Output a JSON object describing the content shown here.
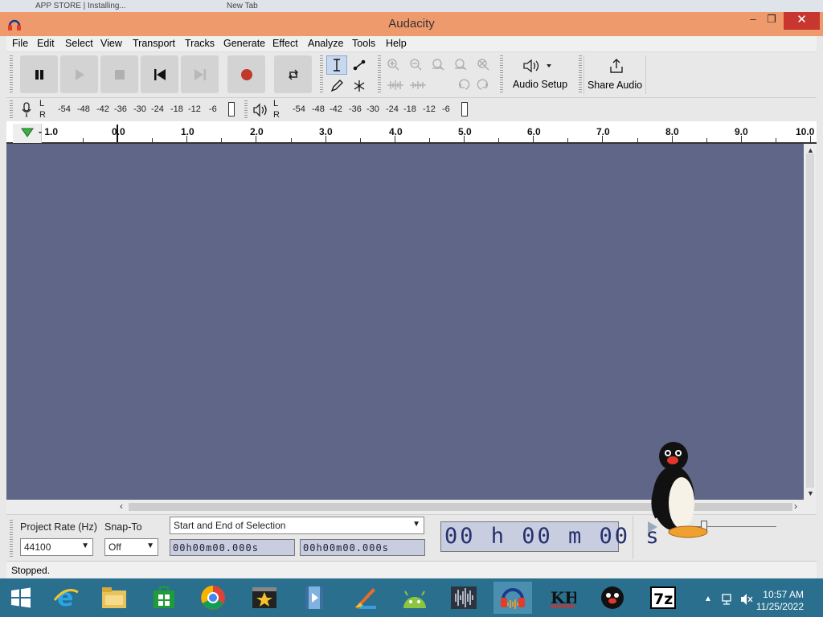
{
  "background_tabs": [
    "APP STORE | Installing...",
    "New Tab"
  ],
  "window": {
    "title": "Audacity",
    "minimize": "–",
    "restore": "❐",
    "close": "✕"
  },
  "menu": [
    "File",
    "Edit",
    "Select",
    "View",
    "Transport",
    "Tracks",
    "Generate",
    "Effect",
    "Analyze",
    "Tools",
    "Help"
  ],
  "toolbar": {
    "audio_setup": "Audio Setup",
    "share_audio": "Share Audio"
  },
  "meters": {
    "record_lr": [
      "L",
      "R"
    ],
    "playback_lr": [
      "L",
      "R"
    ],
    "record_ticks": [
      "-54",
      "-48",
      "-42",
      "-36",
      "-30",
      "-24",
      "-18",
      "-12",
      "-6"
    ],
    "playback_ticks": [
      "-54",
      "-48",
      "-42",
      "-36",
      "-30",
      "-24",
      "-18",
      "-12",
      "-6"
    ]
  },
  "ruler": {
    "labels": [
      "- 1.0",
      "0.0",
      "1.0",
      "2.0",
      "3.0",
      "4.0",
      "5.0",
      "6.0",
      "7.0",
      "8.0",
      "9.0",
      "10.0"
    ]
  },
  "selection": {
    "project_rate_label": "Project Rate (Hz)",
    "project_rate_value": "44100",
    "snap_to_label": "Snap-To",
    "snap_to_value": "Off",
    "selection_mode": "Start and End of Selection",
    "start_time": "00h00m00.000s",
    "end_time": "00h00m00.000s",
    "audio_position": "00 h 00 m 00 s"
  },
  "status": {
    "text": "Stopped."
  },
  "colors": {
    "titlebar": "#ef9a6d",
    "track_area": "#5f6687",
    "taskbar": "#2a6f8e",
    "close": "#c7372f"
  },
  "taskbar": {
    "apps": [
      "start-icon",
      "internet-explorer-icon",
      "file-explorer-icon",
      "store-icon",
      "chrome-icon",
      "movie-maker-icon",
      "video-icon",
      "paint-icon",
      "android-icon",
      "wave-editor-icon",
      "audacity-icon",
      "kh-icon",
      "pingu-icon",
      "7zip-icon"
    ],
    "time": "10:57 AM",
    "date": "11/25/2022"
  }
}
